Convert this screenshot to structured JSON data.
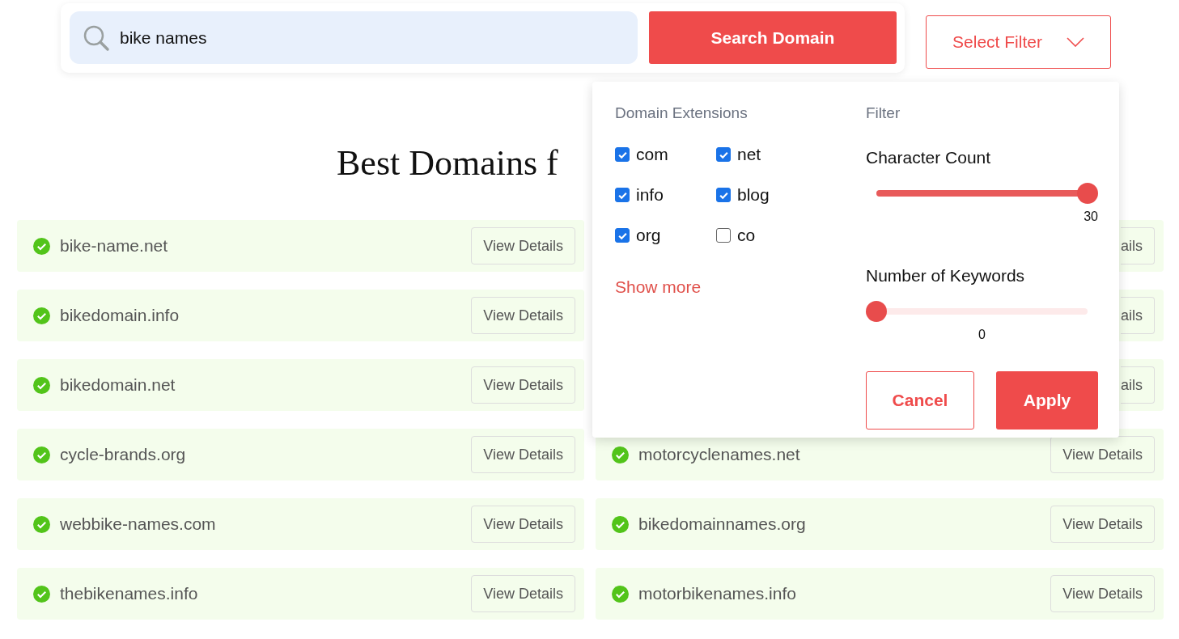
{
  "search": {
    "value": "bike names",
    "button": "Search Domain"
  },
  "filter_button": "Select Filter",
  "heading": "Best Domains f",
  "columns": [
    [
      {
        "kind": "full",
        "domain": "bike-name.net",
        "button": "View Details"
      },
      {
        "kind": "full",
        "domain": "bikedomain.info",
        "button": "View Details"
      },
      {
        "kind": "full",
        "domain": "bikedomain.net",
        "button": "View Details"
      },
      {
        "kind": "full",
        "domain": "cycle-brands.org",
        "button": "View Details"
      },
      {
        "kind": "full",
        "domain": "webbike-names.com",
        "button": "View Details"
      },
      {
        "kind": "full",
        "domain": "thebikenames.info",
        "button": "View Details"
      }
    ],
    [
      {
        "kind": "covered",
        "button": "ails"
      },
      {
        "kind": "covered",
        "button": "ails"
      },
      {
        "kind": "covered",
        "button": "ails"
      },
      {
        "kind": "full",
        "domain": "motorcyclenames.net",
        "button": "View Details"
      },
      {
        "kind": "full",
        "domain": "bikedomainnames.org",
        "button": "View Details"
      },
      {
        "kind": "full",
        "domain": "motorbikenames.info",
        "button": "View Details"
      }
    ]
  ],
  "filter_popup": {
    "extensions_title": "Domain Extensions",
    "extensions": [
      {
        "label": "com",
        "checked": true
      },
      {
        "label": "net",
        "checked": true
      },
      {
        "label": "info",
        "checked": true
      },
      {
        "label": "blog",
        "checked": true
      },
      {
        "label": "org",
        "checked": true
      },
      {
        "label": "co",
        "checked": false
      }
    ],
    "show_more": "Show more",
    "filter_title": "Filter",
    "sliders": [
      {
        "label": "Character Count",
        "level": 1,
        "reading": "30"
      },
      {
        "label": "Number of Keywords",
        "level": 0,
        "reading": "0"
      }
    ],
    "cancel": "Cancel",
    "apply": "Apply"
  }
}
